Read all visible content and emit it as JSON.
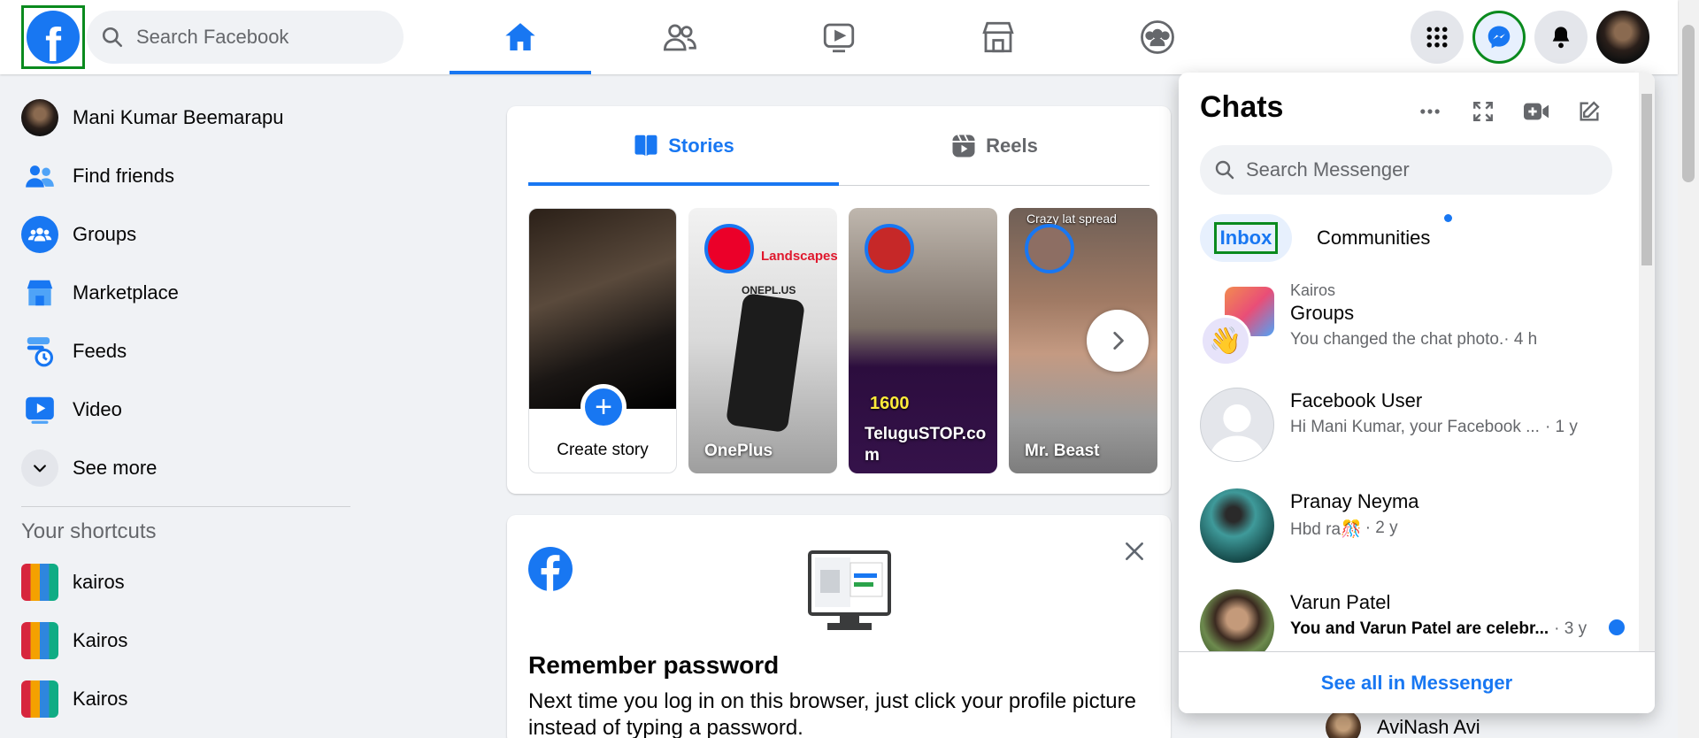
{
  "header": {
    "logo_letter": "f",
    "search_placeholder": "Search Facebook",
    "nav": [
      "home-icon",
      "friends-icon",
      "watch-icon",
      "marketplace-icon",
      "groups-icon"
    ],
    "active_nav": "home-icon",
    "right": [
      "menu-grid-icon",
      "messenger-icon",
      "notifications-icon",
      "account-avatar"
    ]
  },
  "sidebar": {
    "items": [
      {
        "label": "Mani Kumar Beemarapu",
        "icon": "profile-avatar"
      },
      {
        "label": "Find friends",
        "icon": "friends-icon"
      },
      {
        "label": "Groups",
        "icon": "groups-icon"
      },
      {
        "label": "Marketplace",
        "icon": "marketplace-icon"
      },
      {
        "label": "Feeds",
        "icon": "feeds-icon"
      },
      {
        "label": "Video",
        "icon": "video-icon"
      },
      {
        "label": "See more",
        "icon": "chevron-down-icon"
      }
    ],
    "shortcuts_title": "Your shortcuts",
    "shortcuts": [
      {
        "label": "kairos"
      },
      {
        "label": "Kairos"
      },
      {
        "label": "Kairos"
      }
    ]
  },
  "stories": {
    "tabs": [
      {
        "label": "Stories",
        "active": true
      },
      {
        "label": "Reels",
        "active": false
      }
    ],
    "create_label": "Create story",
    "items": [
      {
        "name": "OnePlus",
        "overlay_lines": [
          "Landscapes",
          "ONEPL.US"
        ]
      },
      {
        "name": "TeluguSTOP.co m",
        "overlay_lines": [
          "1600"
        ]
      },
      {
        "name": "Mr. Beast",
        "overlay_lines": [
          "Crazy lat spread"
        ]
      }
    ]
  },
  "remember_password": {
    "title": "Remember password",
    "body": "Next time you log in on this browser, just click your profile picture instead of typing a password."
  },
  "chats": {
    "title": "Chats",
    "search_placeholder": "Search Messenger",
    "filters": [
      {
        "label": "Inbox",
        "active": true
      },
      {
        "label": "Communities",
        "active": false
      }
    ],
    "conversations": [
      {
        "supertitle": "Kairos",
        "name": "Groups",
        "message": "You changed the chat photo.",
        "time": "· 4 h",
        "unread": false
      },
      {
        "supertitle": "",
        "name": "Facebook User",
        "message": "Hi Mani Kumar, your Facebook ...",
        "time": "· 1 y",
        "unread": false
      },
      {
        "supertitle": "",
        "name": "Pranay Neyma",
        "message": "Hbd ra🎊",
        "time": "· 2 y",
        "unread": false
      },
      {
        "supertitle": "",
        "name": "Varun Patel",
        "message": "You and Varun Patel are celebr...",
        "time": "· 3 y",
        "unread": true
      }
    ],
    "see_all": "See all in Messenger"
  },
  "contacts_peek": {
    "name": "AviNash Avi"
  },
  "colors": {
    "accent": "#1877f2",
    "highlight_box": "#0a8a1e",
    "bg": "#f0f2f5"
  }
}
